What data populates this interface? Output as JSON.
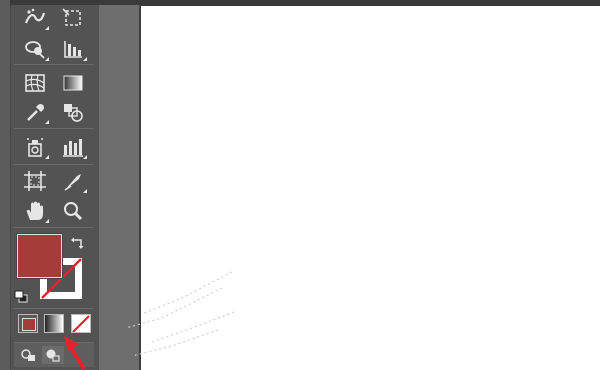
{
  "colors": {
    "toolbar_bg": "#535353",
    "canvas_bg": "#ffffff",
    "fill_color": "#a43c37",
    "stroke_color": "none",
    "annotation_arrow": "#e8222a"
  },
  "toolbar": {
    "tools": [
      {
        "name": "symbol-sprayer-icon"
      },
      {
        "name": "artboard-icon"
      },
      {
        "name": "shape-builder-icon"
      },
      {
        "name": "column-graph-icon"
      },
      {
        "name": "mesh-icon"
      },
      {
        "name": "gradient-icon"
      },
      {
        "name": "eyedropper-icon"
      },
      {
        "name": "blend-icon"
      },
      {
        "name": "symbol-sprayer-tool-icon"
      },
      {
        "name": "bar-graph-icon"
      },
      {
        "name": "artboard-tool-icon"
      },
      {
        "name": "slice-icon"
      },
      {
        "name": "hand-icon"
      },
      {
        "name": "zoom-icon"
      }
    ],
    "fill_stroke": {
      "fill": "#a43c37",
      "stroke": "none"
    },
    "color_modes": [
      "color",
      "gradient",
      "none"
    ],
    "draw_modes": [
      "draw-normal",
      "draw-behind"
    ]
  }
}
